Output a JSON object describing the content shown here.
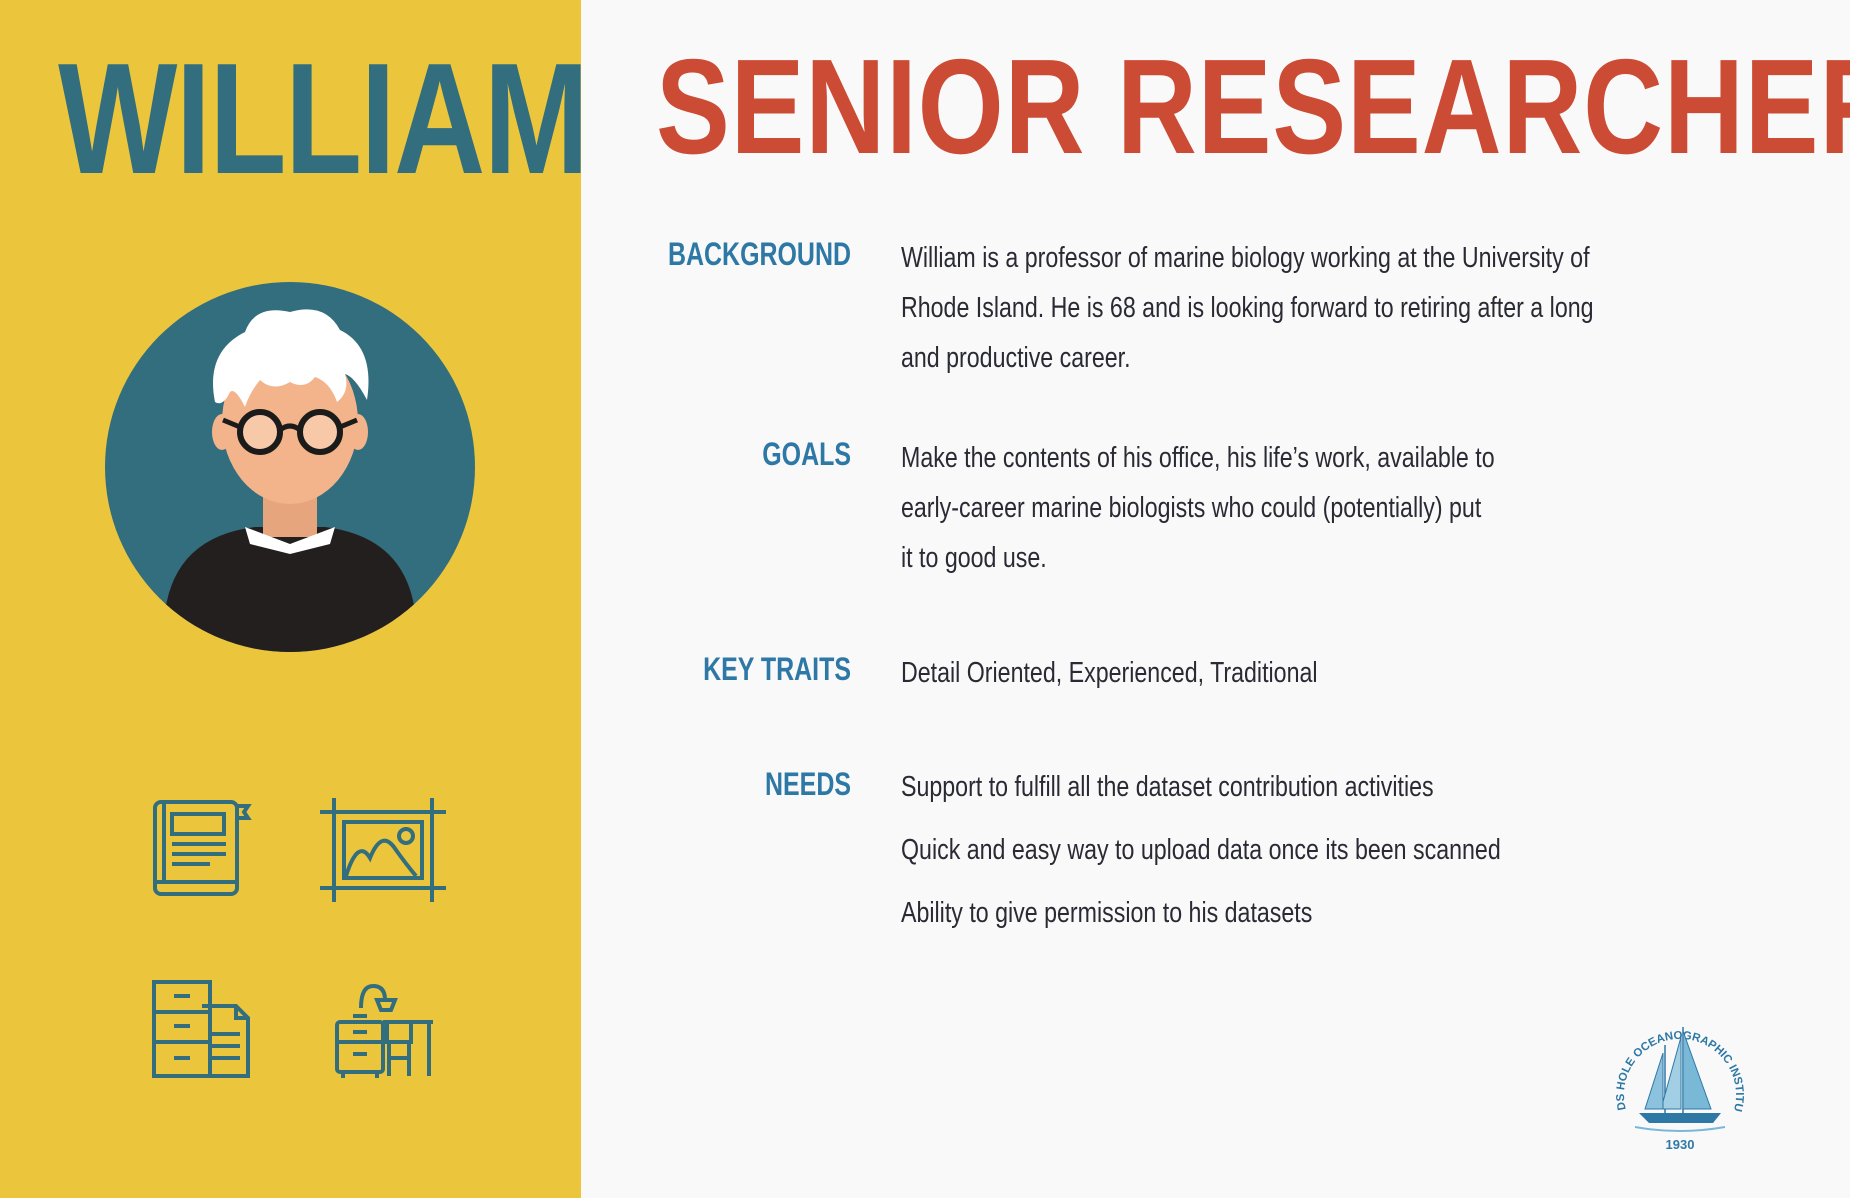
{
  "persona": {
    "name": "WILLIAM",
    "role": "SENIOR RESEARCHER"
  },
  "sections": {
    "background": {
      "label": "BACKGROUND",
      "lines": [
        "William is a professor of marine biology working at the University of",
        "Rhode Island. He is 68 and is looking forward to retiring after a long",
        "and productive career."
      ]
    },
    "goals": {
      "label": "GOALS",
      "lines": [
        "Make the contents of his office, his life’s work, available to",
        "early-career marine biologists who could (potentially) put",
        "it to good use."
      ]
    },
    "key_traits": {
      "label": "KEY TRAITS",
      "lines": [
        "Detail Oriented, Experienced, Traditional"
      ]
    },
    "needs": {
      "label": "NEEDS",
      "lines": [
        "Support to fulfill all the dataset contribution activities",
        "Quick and easy way to upload data once its been scanned",
        "Ability to give permission to his datasets"
      ]
    }
  },
  "icons": [
    "book-icon",
    "picture-frame-icon",
    "file-cabinet-icon",
    "desk-icon"
  ],
  "logo": {
    "text": "WOODS HOLE OCEANOGRAPHIC INSTITUTION",
    "year": "1930"
  },
  "colors": {
    "left_panel": "#ebc63d",
    "name": "#326e7e",
    "role": "#cc4b34",
    "labels": "#2e78a6",
    "body_text": "#2a2a34",
    "icon_stroke": "#326e7e"
  }
}
